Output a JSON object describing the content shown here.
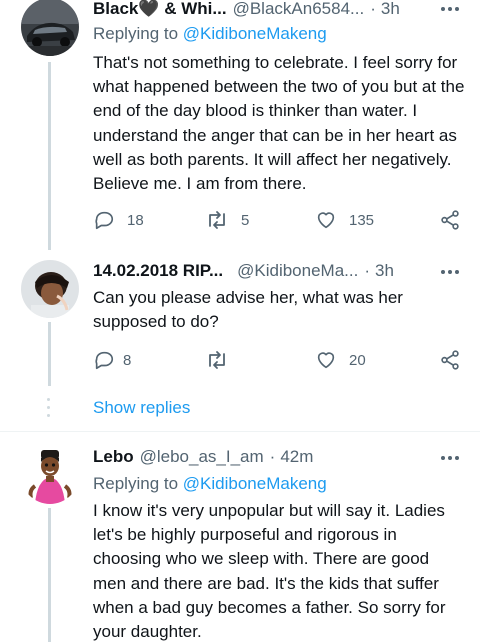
{
  "tweets": [
    {
      "name": "Black🖤 & Whi...",
      "handle": "@BlackAn6584...",
      "separator": "·",
      "time": "3h",
      "replying_prefix": "Replying to",
      "replying_to": "@KidiboneMakeng",
      "text": "That's not something to celebrate. I feel sorry for what happened between the two of you but at the end of the day blood is thinker than water. I understand the anger that can be in her heart as well as both parents. It will affect her negatively. Believe me. I am from there.",
      "replies": "18",
      "retweets": "5",
      "likes": "135"
    },
    {
      "name": "14.02.2018 RIP...",
      "handle": "@KidiboneMa...",
      "separator": "·",
      "time": "3h",
      "text": "Can you please advise her, what was her supposed to do?",
      "replies": "8",
      "retweets": "",
      "likes": "20"
    },
    {
      "name": "Lebo",
      "handle": "@lebo_as_I_am",
      "separator": "·",
      "time": "42m",
      "replying_prefix": "Replying to",
      "replying_to": "@KidiboneMakeng",
      "text": "I know it's very unpopular but will say it. Ladies let's be highly purposeful and rigorous in choosing who we sleep with. There are good men and there are bad. It's the kids that suffer when a bad guy becomes a father. So sorry for your daughter."
    }
  ],
  "show_replies": "Show replies",
  "colors": {
    "accent": "#1d9bf0",
    "text": "#0f1419",
    "secondary": "#536471",
    "line": "#cfd9de"
  }
}
